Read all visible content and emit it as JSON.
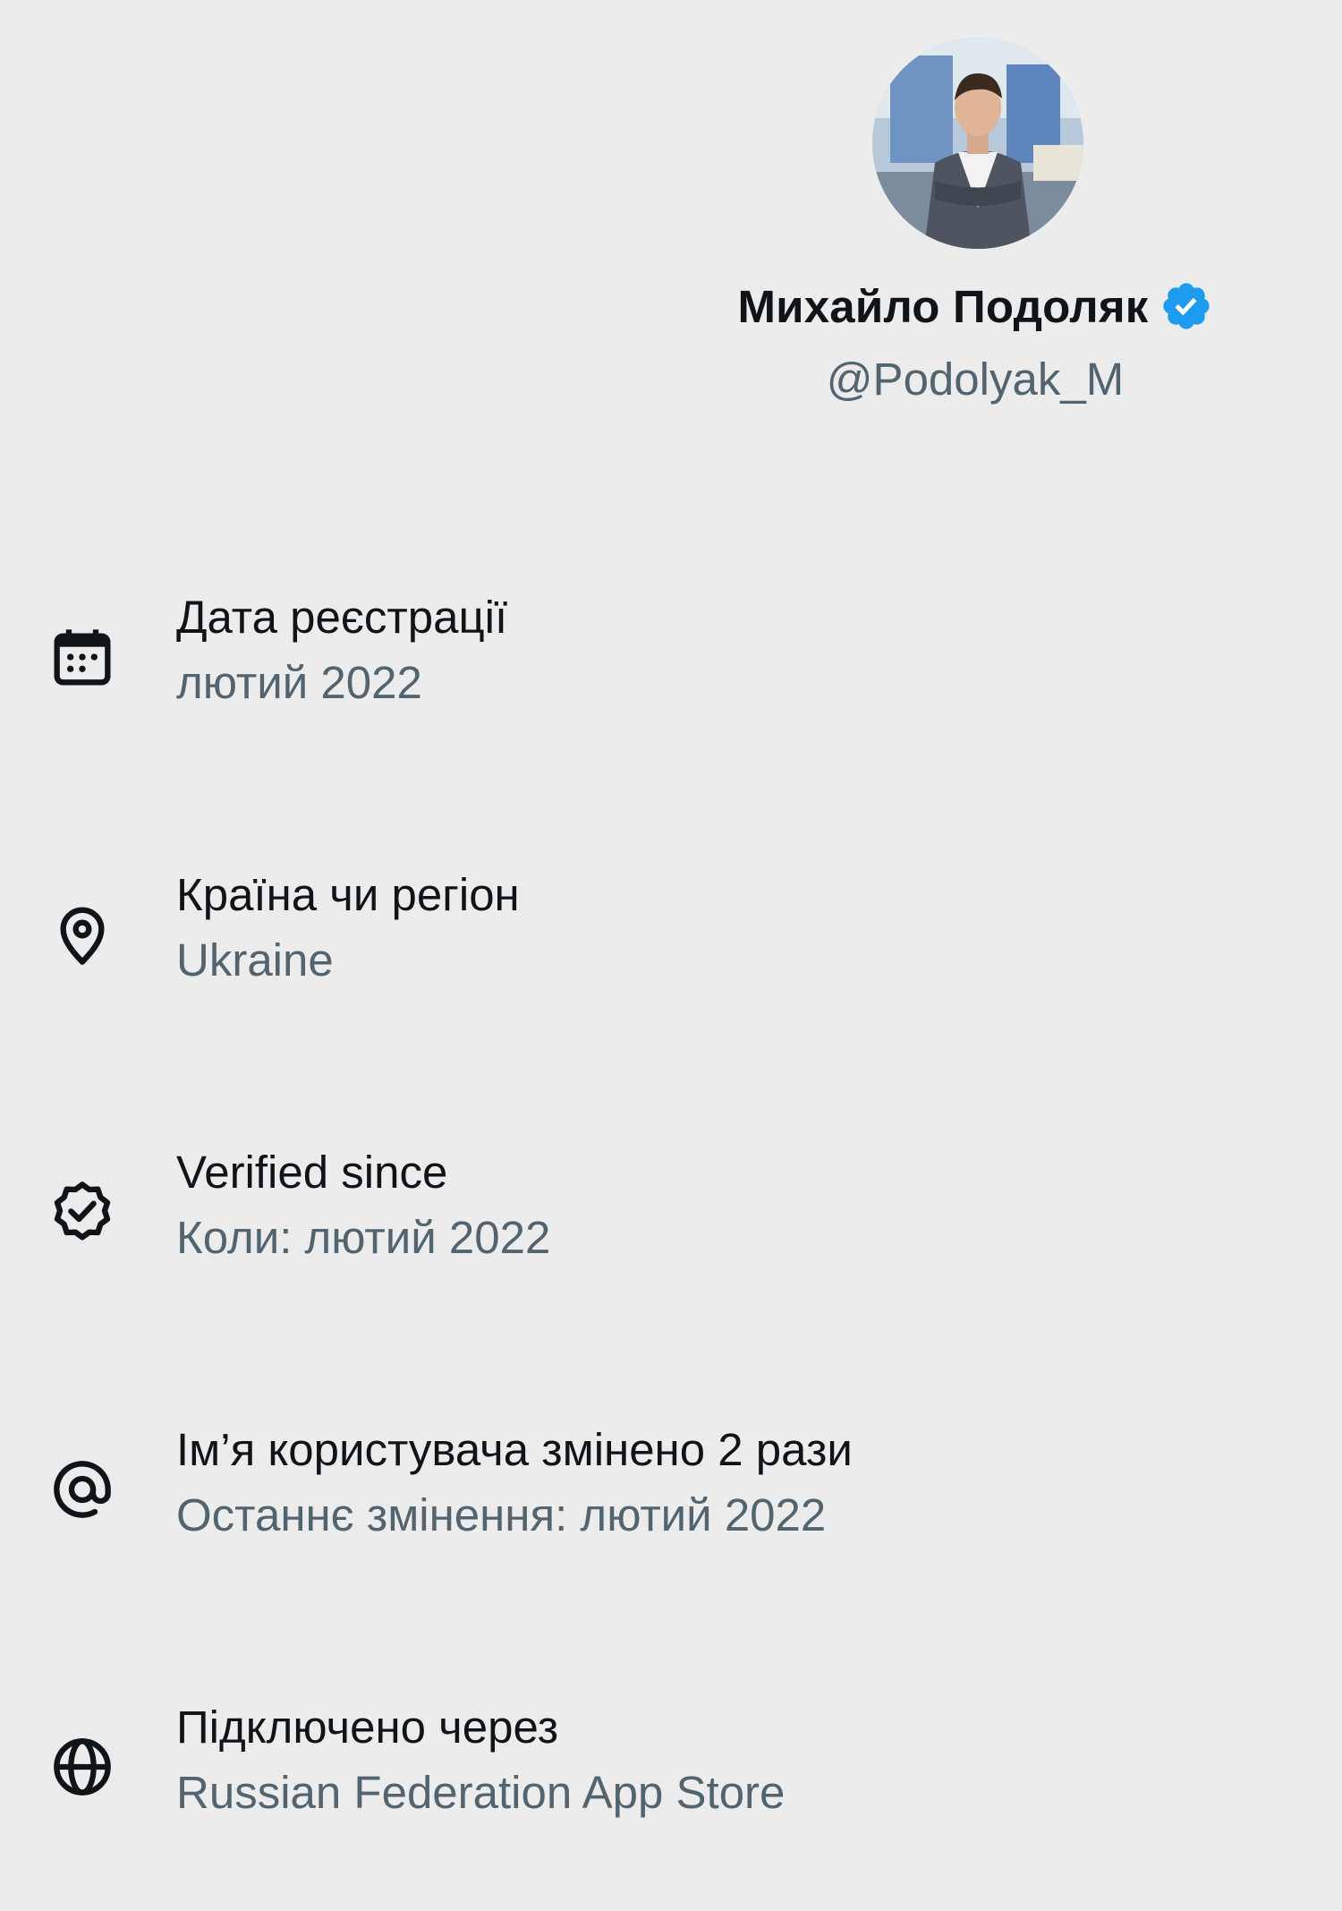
{
  "profile": {
    "display_name": "Михайло Подоляк",
    "handle": "@Podolyak_M",
    "verified": true,
    "avatar_icon": "profile-photo",
    "badge_color": "#1d9bf0"
  },
  "info_rows": [
    {
      "icon": "calendar-icon",
      "title": "Дата реєстрації",
      "value": "лютий 2022"
    },
    {
      "icon": "location-pin-icon",
      "title": "Країна чи регіон",
      "value": "Ukraine"
    },
    {
      "icon": "verified-check-icon",
      "title": "Verified since",
      "value": "Коли: лютий 2022"
    },
    {
      "icon": "at-sign-icon",
      "title": "Ім’я користувача змінено 2 рази",
      "value": "Останнє змінення: лютий 2022"
    },
    {
      "icon": "globe-icon",
      "title": "Підключено через",
      "value": "Russian Federation App Store"
    }
  ],
  "colors": {
    "background": "#ececec",
    "primary_text": "#0f1419",
    "secondary_text": "#536471"
  }
}
